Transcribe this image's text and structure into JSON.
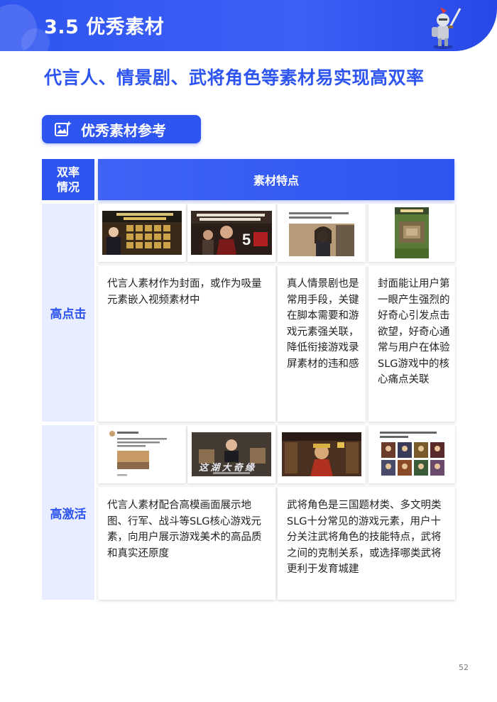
{
  "header": {
    "title": "3.5 优秀素材"
  },
  "subtitle": "代言人、情景剧、武将角色等素材易实现高双率",
  "tag": {
    "icon": "image-sparkle-icon",
    "label": "优秀素材参考"
  },
  "table": {
    "col1_header": "双率情况",
    "col2_header": "素材特点",
    "rows": [
      {
        "label": "高点击",
        "descriptions": [
          "代言人素材作为封面，或作为吸量元素嵌入视频素材中",
          "真人情景剧也是常用手段，关键在脚本需要和游戏元素强关联，降低衔接游戏录屏素材的违和感",
          "封面能让用户第一眼产生强烈的好奇心引发点击欲望，好奇心通常与用户在体验SLG游戏中的核心痛点关联"
        ]
      },
      {
        "label": "高激活",
        "descriptions": [
          "代言人素材配合高模画面展示地图、行军、战斗等SLG核心游戏元素，向用户展示游戏美术的高品质和真实还原度",
          "武将角色是三国题材类、多文明类SLG十分常见的游戏元素，用户十分关注武将角色的技能特点，武将之间的克制关系，或选择哪类武将更利于发育城建"
        ]
      }
    ]
  },
  "page_number": "52",
  "colors": {
    "primary": "#2f55f0",
    "row_label_bg": "#e8edff"
  }
}
